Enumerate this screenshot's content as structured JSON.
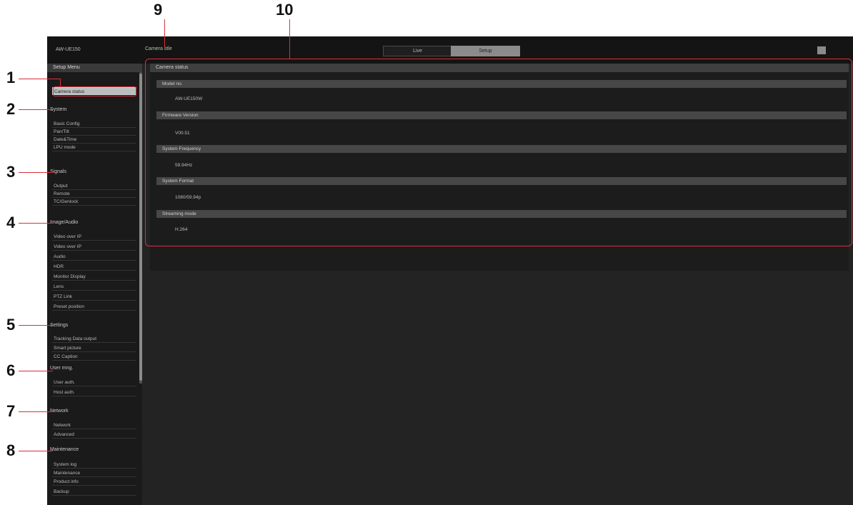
{
  "callouts": [
    "1",
    "2",
    "3",
    "4",
    "5",
    "6",
    "7",
    "8",
    "9",
    "10"
  ],
  "header": {
    "model": "AW-UE150",
    "camera_title": "Camera title",
    "tab_live": "Live",
    "tab_setup": "Setup"
  },
  "sidebar": {
    "title": "Setup Menu",
    "selected": "Camera status",
    "groups": {
      "system": "System",
      "signals": "Signals",
      "image": "Image/Audio",
      "settings": "Settings",
      "user_mng": "User mng.",
      "network": "Network",
      "maintenance": "Maintenance"
    },
    "items": {
      "basic_config": "Basic Config",
      "pan_tilt": "Pan/Tilt",
      "date_time": "Date&Time",
      "lens_mode": "LPU mode",
      "output": "Output",
      "remote": "Remote",
      "tc_genlock": "TC/Genlock",
      "video_over_ip": "Video over IP",
      "video_over_ip_2": "Video over IP",
      "audio": "Audio",
      "hdr": "HDR",
      "monitor_display": "Monitor Display",
      "lens": "Lens",
      "ptz_link": "PTZ Link",
      "preset_position": "Preset position",
      "tracking_data_output": "Tracking Data output",
      "smart_picture": "Smart picture",
      "cc_caption": "CC Caption",
      "user_auth": "User auth.",
      "host_auth": "Host auth.",
      "network": "Network",
      "advanced": "Advanced",
      "system_log": "System log",
      "maintenance": "Maintenance",
      "product_info": "Product info",
      "backup": "Backup"
    }
  },
  "main": {
    "title": "Camera status",
    "fields": [
      {
        "label": "Model no.",
        "value": "AW-UE150W"
      },
      {
        "label": "Firmware Version",
        "value": "V00.51"
      },
      {
        "label": "System Frequency",
        "value": "59.94Hz"
      },
      {
        "label": "System Format",
        "value": "1080/59.94p"
      },
      {
        "label": "Streaming mode",
        "value": "H.264"
      }
    ]
  }
}
